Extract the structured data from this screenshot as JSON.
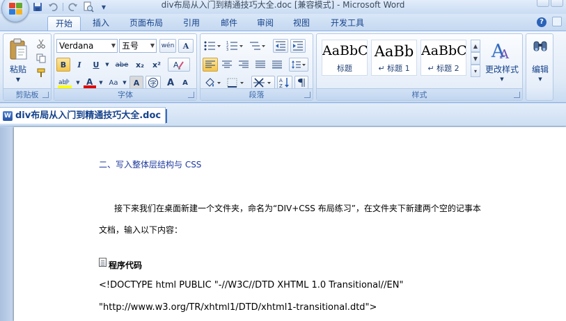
{
  "window": {
    "title": "div布局从入门到精通技巧大全.doc [兼容模式] - Microsoft Word"
  },
  "quick_access": {
    "items": [
      "save-icon",
      "undo-icon",
      "redo-icon",
      "print-preview-icon",
      "customize-dropdown-icon"
    ]
  },
  "tabs": [
    {
      "label": "开始",
      "active": true
    },
    {
      "label": "插入",
      "active": false
    },
    {
      "label": "页面布局",
      "active": false
    },
    {
      "label": "引用",
      "active": false
    },
    {
      "label": "邮件",
      "active": false
    },
    {
      "label": "审阅",
      "active": false
    },
    {
      "label": "视图",
      "active": false
    },
    {
      "label": "开发工具",
      "active": false
    }
  ],
  "ribbon": {
    "clipboard": {
      "label": "剪贴板",
      "paste_label": "粘贴"
    },
    "font": {
      "label": "字体",
      "font_name": "Verdana",
      "font_size": "五号",
      "bold": "B",
      "italic": "I",
      "underline": "U",
      "strike": "abe",
      "subscript": "x₂",
      "superscript": "x²",
      "change_case": "Aa",
      "grow": "A",
      "shrink": "A",
      "wen": "wén",
      "char_border": "A"
    },
    "paragraph": {
      "label": "段落"
    },
    "styles": {
      "label": "样式",
      "items": [
        {
          "sample": "AaBbC",
          "name": "标题"
        },
        {
          "sample": "AaBb",
          "name": "↵ 标题 1"
        },
        {
          "sample": "AaBbC",
          "name": "↵ 标题 2"
        }
      ],
      "change_styles_label": "更改样式"
    },
    "editing": {
      "label": "编辑"
    }
  },
  "document": {
    "tab_label": "div布局从入门到精通技巧大全.doc",
    "paragraphs": {
      "heading": "二、写入整体层结构与 CSS",
      "p1": "接下来我们在桌面新建一个文件夹，命名为“DIV+CSS 布局练习”，在文件夹下新建两个空的记事本",
      "p2": "文档，输入以下内容：",
      "code_title": "程序代码",
      "code_line1": "<!DOCTYPE html PUBLIC \"-//W3C//DTD XHTML 1.0 Transitional//EN\"",
      "code_line2": "\"http://www.w3.org/TR/xhtml1/DTD/xhtml1-transitional.dtd\">"
    }
  },
  "colors": {
    "ribbon_text": "#15428b",
    "heading_text": "#1f3a9c",
    "highlight_yellow": "#ffff00",
    "font_color_red": "#e00000"
  }
}
